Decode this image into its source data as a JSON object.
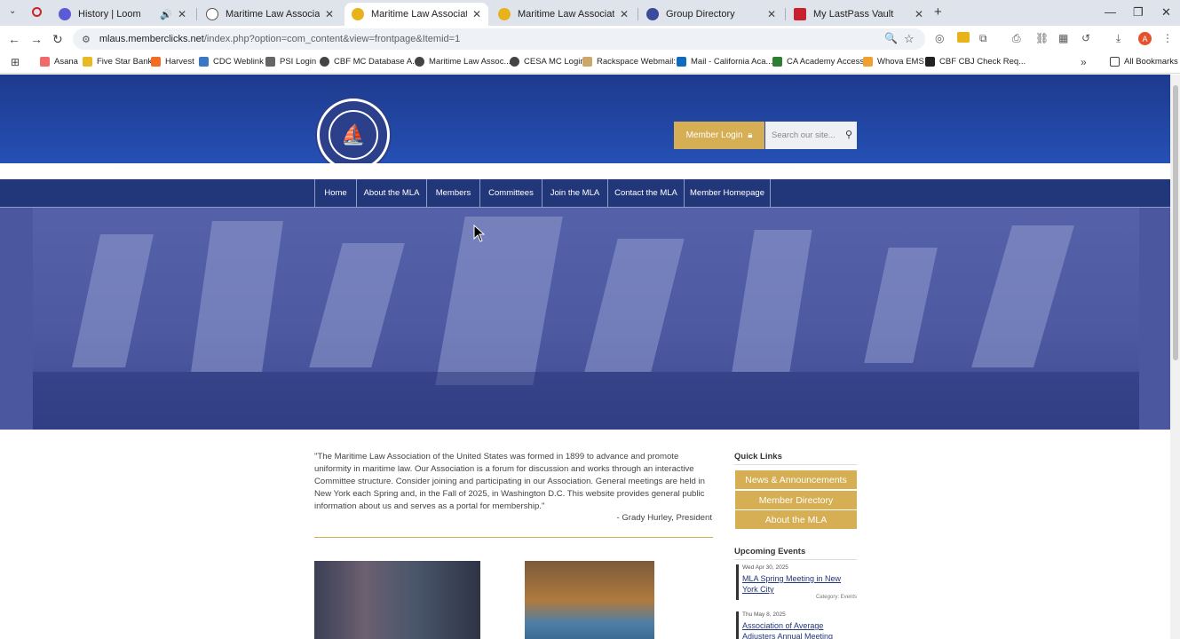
{
  "browser": {
    "tabs": [
      {
        "title": "History | Loom",
        "favicon_color": "#5b5bd6"
      },
      {
        "title": "Maritime Law Association - Ad",
        "favicon_color": "#555555"
      },
      {
        "title": "Maritime Law Association",
        "favicon_color": "#e7b21a",
        "active": true
      },
      {
        "title": "Maritime Law Association",
        "favicon_color": "#e7b21a"
      },
      {
        "title": "Group Directory",
        "favicon_color": "#3b4a9a"
      },
      {
        "title": "My LastPass Vault",
        "favicon_color": "#c8202d"
      }
    ],
    "url_host": "mlaus.memberclicks.net",
    "url_path": "/index.php?option=com_content&view=frontpage&Itemid=1",
    "bookmarks": [
      {
        "label": "Asana",
        "color": "#f06a6a"
      },
      {
        "label": "Five Star Bank",
        "color": "#e8b923"
      },
      {
        "label": "Harvest",
        "color": "#f36c21"
      },
      {
        "label": "CDC Weblink",
        "color": "#3a78c3"
      },
      {
        "label": "PSI Login",
        "color": "#666666"
      },
      {
        "label": "CBF MC Database A...",
        "color": "#444444"
      },
      {
        "label": "Maritime Law Assoc...",
        "color": "#444444"
      },
      {
        "label": "CESA MC Login",
        "color": "#444444"
      },
      {
        "label": "Rackspace Webmail:...",
        "color": "#c9a86a"
      },
      {
        "label": "Mail - California Aca...",
        "color": "#0f6cbd"
      },
      {
        "label": "CA Academy Access",
        "color": "#2e7d32"
      },
      {
        "label": "Whova EMS",
        "color": "#f0a030"
      },
      {
        "label": "CBF CBJ Check Req...",
        "color": "#222222"
      }
    ],
    "all_bookmarks": "All Bookmarks"
  },
  "site": {
    "member_login": "Member Login",
    "search_placeholder": "Search our site...",
    "nav": [
      "Home",
      "About the MLA",
      "Members",
      "Committees",
      "Join the MLA",
      "Contact the MLA",
      "Member Homepage"
    ],
    "quote": "\"The Maritime Law Association of the United States was formed in 1899 to advance and promote uniformity in maritime law. Our Association is a forum for discussion and works through an interactive Committee structure. Consider joining and participating in our Association. General meetings are held in New York each Spring and, in the Fall of 2025, in Washington D.C. This website provides general public information about us and serves as a portal for membership.\"",
    "attribution": "- Grady Hurley, President",
    "quick_links_title": "Quick Links",
    "quick_links": [
      "News & Announcements",
      "Member Directory",
      "About the MLA"
    ],
    "upcoming_title": "Upcoming Events",
    "events": [
      {
        "date": "Wed Apr 30, 2025",
        "title": "MLA Spring Meeting in New York City",
        "category": "Category: Events"
      },
      {
        "date": "Thu May 8, 2025",
        "title": "Association of Average Adjusters Annual Meeting",
        "category": ""
      }
    ]
  },
  "colors": {
    "brand_blue": "#22367a",
    "gold": "#d6ae53"
  }
}
